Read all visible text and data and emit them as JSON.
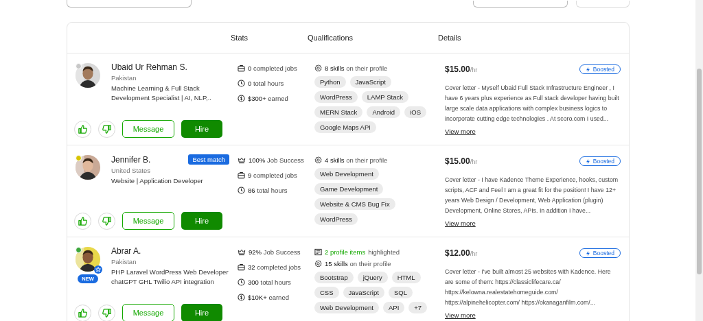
{
  "table": {
    "columns": [
      "Stats",
      "Qualifications",
      "Details"
    ],
    "rows": [
      {
        "name": "Ubaid Ur Rehman S.",
        "color": "#c8c8c8",
        "verified": false,
        "new_badge": null,
        "best_match": null,
        "location": "Pakistan",
        "title": "Machine Learning & Full Stack Development Specialist | AI, NLP,..",
        "actions": {
          "message": "Message",
          "hire": "Hire"
        },
        "stats": [
          {
            "kind": "jobs",
            "text": "**0** completed jobs"
          },
          {
            "kind": "hours",
            "text": "**0** total hours"
          },
          {
            "kind": "earned",
            "text": "**$300+** earned"
          }
        ],
        "highlight": null,
        "skills_line": "**8 skills** on their profile",
        "skills": [
          "Python",
          "JavaScript",
          "WordPress",
          "LAMP Stack",
          "MERN Stack",
          "Android",
          "iOS",
          "Google Maps API"
        ],
        "rate": "$15.00",
        "rate_unit": "/hr",
        "boosted": "Boosted",
        "cover_letter": "Cover letter - Myself Ubaid Full Stack Infrastructure Engineer , I have 6 years plus experience as Full stack developer having built large scale data applications with complex business logics to incorporate cutting edge technologies . At scoro.com I used...",
        "view_more": "View more"
      },
      {
        "name": "Jennifer B.",
        "color": "#d8c400",
        "verified": false,
        "new_badge": null,
        "best_match": "Best match",
        "location": "United States",
        "title": "Website | Application Developer",
        "actions": {
          "message": "Message",
          "hire": "Hire"
        },
        "stats": [
          {
            "kind": "success",
            "text": "**100%** Job Success"
          },
          {
            "kind": "jobs",
            "text": "**9** completed jobs"
          },
          {
            "kind": "hours",
            "text": "**86** total hours"
          }
        ],
        "highlight": null,
        "skills_line": "**4 skills** on their profile",
        "skills": [
          "Web Development",
          "Game Development",
          "Website & CMS Bug Fix",
          "WordPress"
        ],
        "rate": "$15.00",
        "rate_unit": "/hr",
        "boosted": "Boosted",
        "cover_letter": "Cover letter - I have Kadence Theme Experience, hooks, custom scripts, ACF and Feel I am a great fit for the position! I have 12+ years Web Design / Development, Web Application (plugin) Development, Online Stores, APIs. In addition I have...",
        "view_more": "View more"
      },
      {
        "name": "Abrar A.",
        "color": "#3ca63c",
        "verified": true,
        "new_badge": "NEW",
        "best_match": null,
        "location": "Pakistan",
        "title": "PHP Laravel WordPress Web Developer chatGPT GHL Twilio API integration",
        "actions": {
          "message": "Message",
          "hire": "Hire"
        },
        "stats": [
          {
            "kind": "success",
            "text": "**92%** Job Success"
          },
          {
            "kind": "jobs",
            "text": "**32** completed jobs"
          },
          {
            "kind": "hours",
            "text": "**300** total hours"
          },
          {
            "kind": "earned",
            "text": "**$10K+** earned"
          }
        ],
        "highlight": {
          "count": "2 profile items",
          "text": "highlighted"
        },
        "skills_line": "**15 skills** on their profile",
        "skills": [
          "Bootstrap",
          "jQuery",
          "HTML",
          "CSS",
          "JavaScript",
          "SQL",
          "Web Development",
          "API",
          "+7"
        ],
        "rate": "$12.00",
        "rate_unit": "/hr",
        "boosted": "Boosted",
        "cover_letter": "Cover letter - I've built almost 25 websites with Kadence. Here are some of them: https://classiclifecare.ca/ https://kelowna.realestatehomeguide.com/ https://alpinehelicopter.com/ https://okanaganfilm.com/...",
        "view_more": "View more"
      }
    ]
  }
}
